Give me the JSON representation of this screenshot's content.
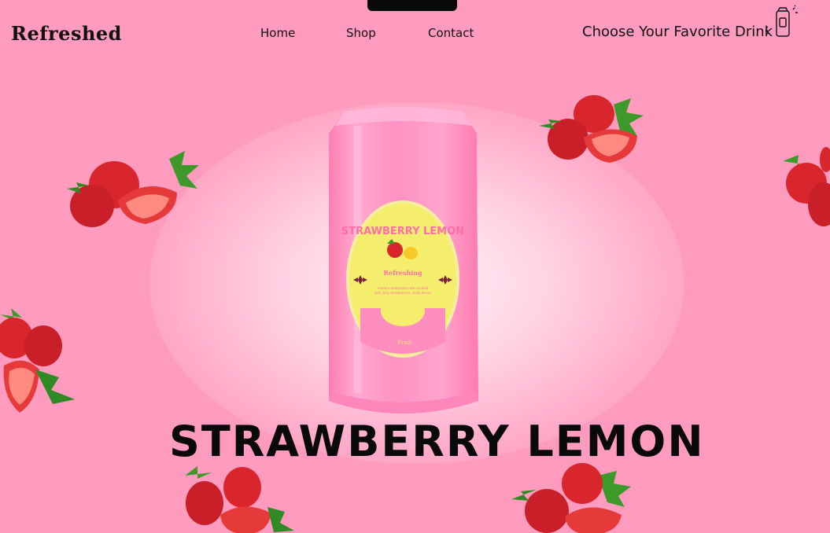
{
  "brand": {
    "logo": "Refreshed"
  },
  "nav": {
    "items": [
      {
        "label": "Home"
      },
      {
        "label": "Shop"
      },
      {
        "label": "Contact"
      }
    ]
  },
  "header": {
    "tagline": "Choose Your Favorite Drink",
    "cart_icon": "soda-can-icon"
  },
  "hero": {
    "title": "STRAWBERRY LEMON",
    "can": {
      "label_title": "STRAWBERRY LEMON",
      "label_sub": "Refreshing",
      "label_desc_1": "modern mangoless new cocktail",
      "label_desc_2": "with juicy strawberries, zesty lemon",
      "label_footer": "Fruit"
    }
  },
  "colors": {
    "background": "#ff9bbf",
    "can": "#ff8fc0",
    "label": "#f4ee6c",
    "text": "#111111"
  }
}
